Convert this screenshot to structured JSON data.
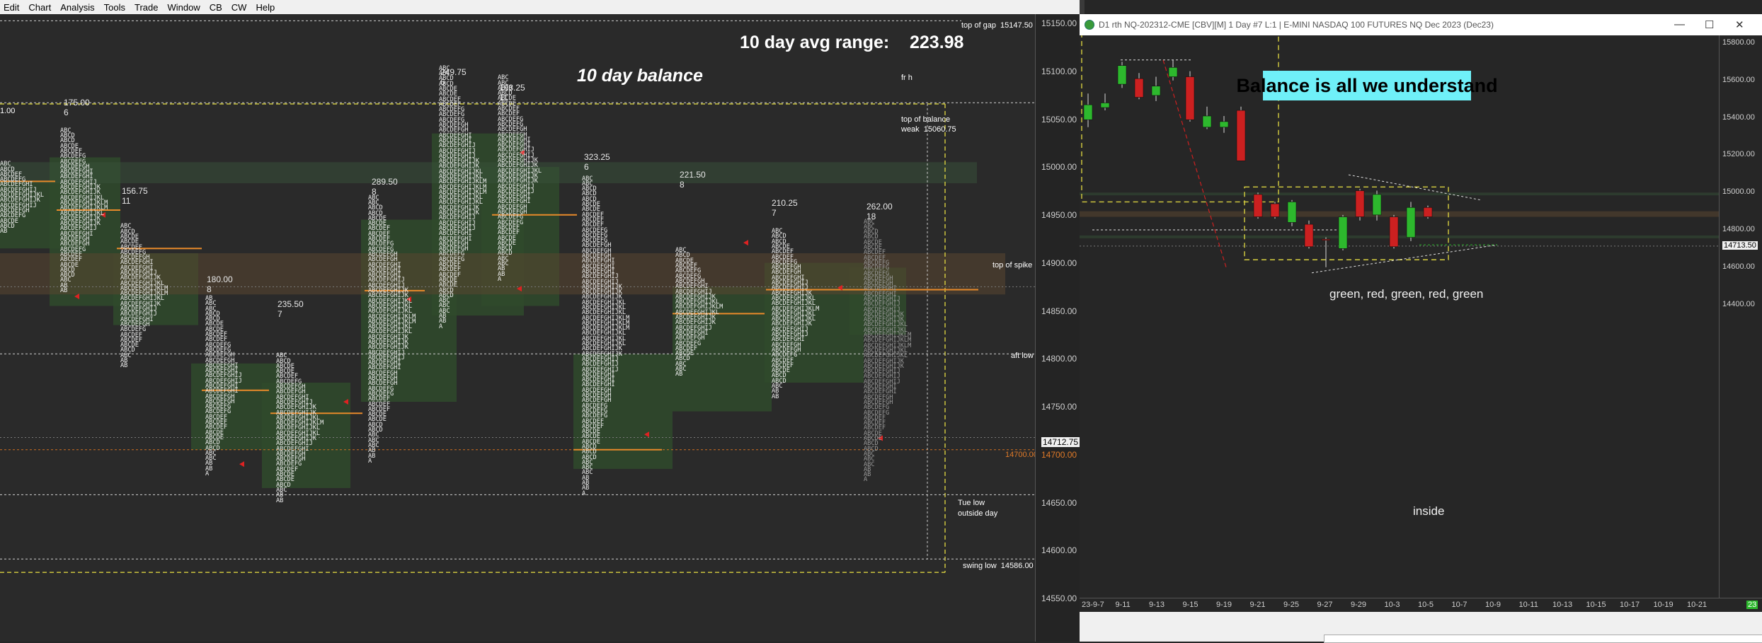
{
  "menu": [
    "Edit",
    "Chart",
    "Analysis",
    "Tools",
    "Trade",
    "Window",
    "CB",
    "CW",
    "Help"
  ],
  "left_chart": {
    "avg_range_label": "10 day avg range:",
    "avg_range_value": "223.98",
    "balance_label": "10 day balance",
    "annotations": {
      "top_of_gap": "top of gap  15147.50",
      "fr_h": "fr h",
      "top_of_balance": "top of balance",
      "weak": "weak  15060.75",
      "top_of_spike": "top of spike",
      "aft_low": "aft low",
      "price_14700": "14700.00",
      "tue_low": "Tue low",
      "outside_day": "outside day",
      "swing_low": "swing low  14586.00",
      "price_1_00": "1.00"
    },
    "profiles": [
      {
        "range": "175.00",
        "count": "6"
      },
      {
        "range": "156.75",
        "count": "11"
      },
      {
        "range": "180.00",
        "count": "8"
      },
      {
        "range": "235.50",
        "count": "7"
      },
      {
        "range": "289.50",
        "count": "8"
      },
      {
        "range": "249.75",
        "count": "6"
      },
      {
        "range": "198.25",
        "count": "11"
      },
      {
        "range": "323.25",
        "count": "6"
      },
      {
        "range": "221.50",
        "count": "8"
      },
      {
        "range": "210.25",
        "count": "7"
      },
      {
        "range": "262.00",
        "count": "18"
      }
    ],
    "price_axis": [
      "15150.00",
      "15100.00",
      "15050.00",
      "15000.00",
      "14950.00",
      "14900.00",
      "14850.00",
      "14800.00",
      "14750.00",
      "14712.75",
      "14700.00",
      "14650.00",
      "14600.00",
      "14550.00"
    ],
    "current_price": "14712.75"
  },
  "right_chart": {
    "title": "D1 rth NQ-202312-CME [CBV][M]  1 Day  #7 L:1 | E-MINI NASDAQ 100 FUTURES NQ Dec 2023 (Dec23)",
    "headline": "Balance is all we understand",
    "pattern_label": "green, red, green, red, green",
    "inside_label": "inside",
    "price_axis": [
      "15800.00",
      "15600.00",
      "15400.00",
      "15200.00",
      "15000.00",
      "14800.00",
      "14713.50",
      "14600.00",
      "14400.00"
    ],
    "current_price": "14713.50",
    "date_axis": [
      "23-9-7",
      "9-11",
      "9-13",
      "9-15",
      "9-19",
      "9-21",
      "9-25",
      "9-27",
      "9-29",
      "10-3",
      "10-5",
      "10-7",
      "10-9",
      "10-11",
      "10-13",
      "10-15",
      "10-17",
      "10-19",
      "10-21"
    ],
    "corner_badge": "23",
    "colors": {
      "up": "#2db82d",
      "down": "#cc2020",
      "headline_bg": "#6ff0f8",
      "dashed_box": "#d8d040"
    },
    "candles": [
      {
        "date": "23-9-7",
        "open": 15390,
        "high": 15530,
        "low": 15350,
        "close": 15470,
        "dir": "up"
      },
      {
        "date": "9-8",
        "open": 15455,
        "high": 15530,
        "low": 15440,
        "close": 15480,
        "dir": "up"
      },
      {
        "date": "9-11",
        "open": 15580,
        "high": 15700,
        "low": 15560,
        "close": 15680,
        "dir": "up"
      },
      {
        "date": "9-12",
        "open": 15610,
        "high": 15640,
        "low": 15500,
        "close": 15510,
        "dir": "down"
      },
      {
        "date": "9-13",
        "open": 15520,
        "high": 15620,
        "low": 15490,
        "close": 15570,
        "dir": "up"
      },
      {
        "date": "9-14",
        "open": 15620,
        "high": 15710,
        "low": 15600,
        "close": 15670,
        "dir": "up"
      },
      {
        "date": "9-15",
        "open": 15620,
        "high": 15650,
        "low": 15380,
        "close": 15390,
        "dir": "down"
      },
      {
        "date": "9-18",
        "open": 15350,
        "high": 15460,
        "low": 15340,
        "close": 15410,
        "dir": "up"
      },
      {
        "date": "9-19",
        "open": 15380,
        "high": 15410,
        "low": 15320,
        "close": 15350,
        "dir": "up"
      },
      {
        "date": "9-20",
        "open": 15440,
        "high": 15460,
        "low": 15170,
        "close": 15170,
        "dir": "down"
      },
      {
        "date": "9-21",
        "open": 14990,
        "high": 15000,
        "low": 14860,
        "close": 14870,
        "dir": "down"
      },
      {
        "date": "9-22",
        "open": 14940,
        "high": 14950,
        "low": 14860,
        "close": 14870,
        "dir": "down"
      },
      {
        "date": "9-25",
        "open": 14840,
        "high": 14960,
        "low": 14820,
        "close": 14950,
        "dir": "up"
      },
      {
        "date": "9-26",
        "open": 14830,
        "high": 14850,
        "low": 14700,
        "close": 14710,
        "dir": "down"
      },
      {
        "date": "9-27",
        "open": 14750,
        "high": 14760,
        "low": 14600,
        "close": 14745,
        "dir": "down"
      },
      {
        "date": "9-28",
        "open": 14700,
        "high": 14880,
        "low": 14690,
        "close": 14870,
        "dir": "up"
      },
      {
        "date": "9-29",
        "open": 15010,
        "high": 15020,
        "low": 14850,
        "close": 14870,
        "dir": "down"
      },
      {
        "date": "10-2",
        "open": 14880,
        "high": 15010,
        "low": 14850,
        "close": 14990,
        "dir": "up"
      },
      {
        "date": "10-3",
        "open": 14870,
        "high": 14880,
        "low": 14700,
        "close": 14710,
        "dir": "down"
      },
      {
        "date": "10-4",
        "open": 14760,
        "high": 14950,
        "low": 14740,
        "close": 14920,
        "dir": "up"
      },
      {
        "date": "10-5",
        "open": 14920,
        "high": 14930,
        "low": 14860,
        "close": 14870,
        "dir": "down"
      }
    ]
  }
}
